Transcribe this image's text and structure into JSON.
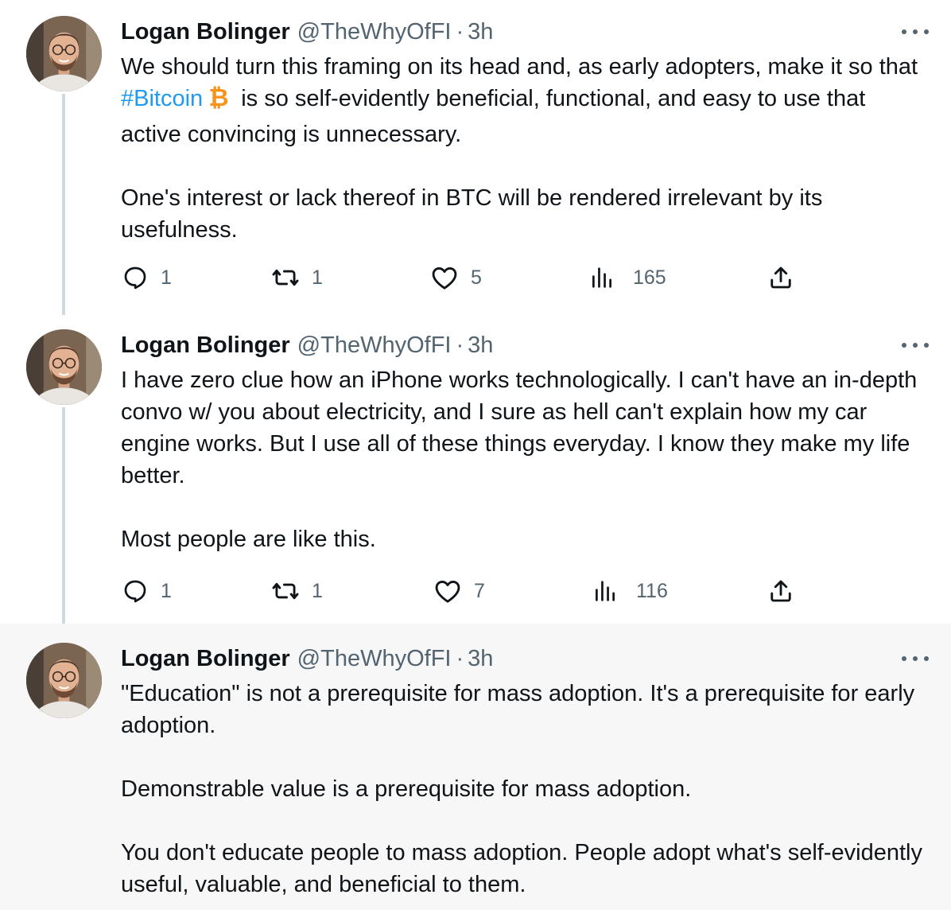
{
  "icons": {
    "reply": "reply-icon",
    "retweet": "retweet-icon",
    "like": "like-icon",
    "views": "views-icon",
    "share": "share-icon",
    "more": "more-icon",
    "bitcoin": "bitcoin-emoji"
  },
  "colors": {
    "text": "#0f1419",
    "secondary": "#536471",
    "link": "#1d9bf0",
    "thread_line": "#cfd9de",
    "highlight_bg": "#f7f7f7",
    "bitcoin": "#f7931a"
  },
  "tweets": [
    {
      "author": {
        "name": "Logan Bolinger",
        "handle": "@TheWhyOfFI"
      },
      "separator": "·",
      "time": "3h",
      "text": {
        "line1_before": "We should turn this framing on its head and, as early adopters, make it so that ",
        "hashtag": "#Bitcoin",
        "emoji": "₿",
        "line1_after": " is so self-evidently beneficial, functional, and easy to use that active convincing is unnecessary.",
        "paragraph2": "One's interest or lack thereof in BTC will be rendered irrelevant by its usefulness."
      },
      "stats": {
        "replies": "1",
        "retweets": "1",
        "likes": "5",
        "views": "165"
      }
    },
    {
      "author": {
        "name": "Logan Bolinger",
        "handle": "@TheWhyOfFI"
      },
      "separator": "·",
      "time": "3h",
      "text": {
        "paragraph1": "I have zero clue how an iPhone works technologically.  I can't have an in-depth convo w/ you about electricity, and I sure as hell can't explain how my car engine works.  But I use all of these things everyday.  I know they make my life better.",
        "paragraph2": "Most people are like this."
      },
      "stats": {
        "replies": "1",
        "retweets": "1",
        "likes": "7",
        "views": "116"
      }
    },
    {
      "author": {
        "name": "Logan Bolinger",
        "handle": "@TheWhyOfFI"
      },
      "separator": "·",
      "time": "3h",
      "text": {
        "paragraph1": "\"Education\" is not a prerequisite for mass adoption. It's a prerequisite for early adoption.",
        "paragraph2": "Demonstrable value is a prerequisite for mass adoption.",
        "paragraph3": "You don't educate people to mass adoption.  People adopt what's self-evidently useful, valuable, and beneficial to them."
      }
    }
  ]
}
